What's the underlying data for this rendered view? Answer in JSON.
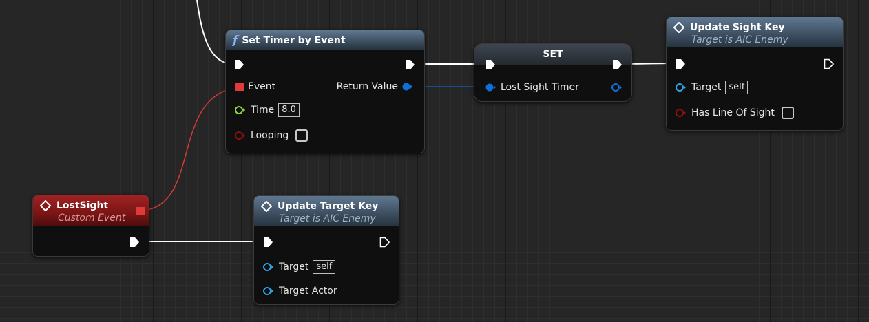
{
  "nodes": {
    "set_timer": {
      "title": "Set Timer by Event",
      "pins": {
        "event": "Event",
        "time": "Time",
        "time_value": "8.0",
        "looping": "Looping",
        "return_value": "Return Value"
      }
    },
    "set_var": {
      "title": "SET",
      "pins": {
        "lost_sight_timer": "Lost Sight Timer"
      }
    },
    "update_sight_key": {
      "title": "Update Sight Key",
      "subtitle": "Target is AIC Enemy",
      "pins": {
        "target": "Target",
        "target_value": "self",
        "has_line_of_sight": "Has Line Of Sight"
      }
    },
    "lost_sight": {
      "title": "LostSight",
      "subtitle": "Custom Event"
    },
    "update_target_key": {
      "title": "Update Target Key",
      "subtitle": "Target is AIC Enemy",
      "pins": {
        "target": "Target",
        "target_value": "self",
        "target_actor": "Target Actor"
      }
    }
  },
  "colors": {
    "exec": "#ffffff",
    "delegate": "#e03b3b",
    "object": "#0f6fd6",
    "float": "#8cd83a",
    "bool": "#7a0c0c",
    "object_ref": "#2fa3e6",
    "header_function": "#3c4d5e",
    "header_event": "#8a1a1a"
  }
}
